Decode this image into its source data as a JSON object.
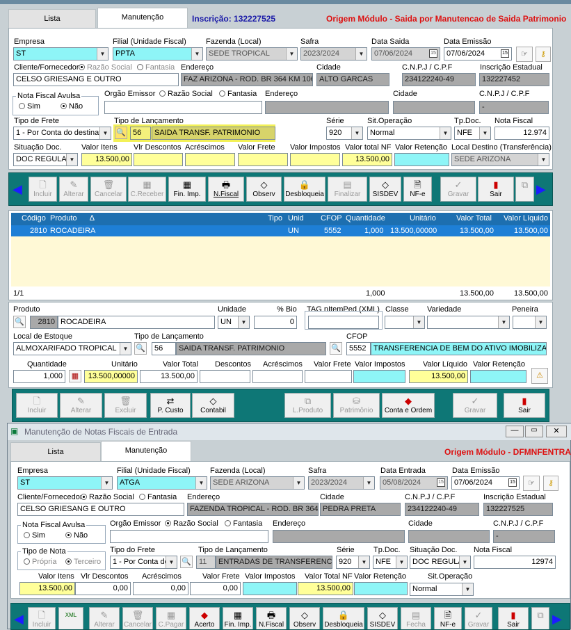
{
  "top": {
    "tabs": [
      "Lista",
      "Manutenção"
    ],
    "inscricao": "Inscrição: 132227525",
    "origem": "Origem Módulo - Saida por Manutencao de Saida Patrimonio",
    "labels": {
      "empresa": "Empresa",
      "filial": "Filial (Unidade Fiscal)",
      "fazenda": "Fazenda (Local)",
      "safra": "Safra",
      "data_saida": "Data Saida",
      "data_emissao": "Data Emissão",
      "cliente": "Cliente/Fornecedor",
      "razao": "Razão Social",
      "fantasia": "Fantasia",
      "endereco": "Endereço",
      "cidade": "Cidade",
      "cnpj": "C.N.P.J / C.P.F",
      "ie": "Inscrição Estadual",
      "nf_avulsa": "Nota Fiscal Avulsa",
      "sim": "Sim",
      "nao": "Não",
      "orgao": "Orgão Emissor",
      "razao2": "Razão Social",
      "fantasia2": "Fantasia",
      "endereco2": "Endereço",
      "cidade2": "Cidade",
      "cnpj2": "C.N.P.J / C.P.F",
      "tipo_frete": "Tipo de Frete",
      "tipo_lanc": "Tipo de Lançamento",
      "serie": "Série",
      "sit_op": "Sit.Operação",
      "tp_doc": "Tp.Doc.",
      "nota_fiscal": "Nota Fiscal",
      "situacao_doc": "Situação Doc.",
      "valor_itens": "Valor Itens",
      "vlr_desc": "Vlr Descontos",
      "acrescimos": "Acréscimos",
      "valor_frete": "Valor Frete",
      "valor_impostos": "Valor Impostos",
      "valor_total_nf": "Valor total NF",
      "valor_retencao": "Valor Retenção",
      "local_destino": "Local Destino (Transferência)"
    },
    "values": {
      "empresa": "ST",
      "filial": "PPTA",
      "fazenda": "SEDE TROPICAL",
      "safra": "2023/2024",
      "data_saida": "07/06/2024",
      "data_emissao": "07/06/2024",
      "cliente": "CELSO GRIESANG E OUTRO",
      "endereco": "FAZ ARIZONA - ROD. BR 364 KM 106",
      "cidade": "ALTO GARCAS",
      "cnpj": "234122240-49",
      "ie": "132227452",
      "cnpj2": "-",
      "tipo_frete": "1 - Por Conta do destinat",
      "tipo_lanc_cod": "56",
      "tipo_lanc_desc": "SAIDA TRANSF. PATRIMONIO",
      "serie": "920",
      "sit_op": "Normal",
      "tp_doc": "NFE",
      "nota_fiscal": "12.974",
      "situacao_doc": "DOC REGULAR",
      "valor_itens": "13.500,00",
      "valor_total_nf": "13.500,00",
      "local_destino": "SEDE ARIZONA"
    },
    "toolbar": [
      "Incluir",
      "Alterar",
      "Cancelar",
      "C.Receber",
      "Fin. Imp.",
      "N.Fiscal",
      "Observ",
      "Desbloqueia",
      "Finalizar",
      "SISDEV",
      "NF-e",
      "Gravar",
      "Sair"
    ],
    "grid": {
      "headers": [
        "Código",
        "Produto",
        "Tipo",
        "Unid",
        "CFOP",
        "Quantidade",
        "Unitário",
        "Valor Total",
        "Valor Líquido"
      ],
      "row": [
        "2810",
        "ROCADEIRA",
        "",
        "UN",
        "5552",
        "1,000",
        "13.500,00000",
        "13.500,00",
        "13.500,00"
      ],
      "footer": [
        "1/1",
        "1,000",
        "13.500,00",
        "13.500,00"
      ]
    },
    "item": {
      "labels": {
        "produto": "Produto",
        "unidade": "Unidade",
        "pct_bio": "% Bio",
        "tag": "TAG nItemPed (XML)",
        "classe": "Classe",
        "variedade": "Variedade",
        "peneira": "Peneira",
        "local_estoque": "Local de Estoque",
        "tipo_lanc": "Tipo de Lançamento",
        "cfop": "CFOP",
        "quantidade": "Quantidade",
        "unitario": "Unitário",
        "valor_total": "Valor Total",
        "descontos": "Descontos",
        "acrescimos": "Acréscimos",
        "valor_frete": "Valor Frete",
        "valor_impostos": "Valor Impostos",
        "valor_liquido": "Valor Líquido",
        "valor_retencao": "Valor Retenção"
      },
      "values": {
        "produto_cod": "2810",
        "produto_desc": "ROCADEIRA",
        "unidade": "UN",
        "pct_bio": "0",
        "local_estoque": "ALMOXARIFADO TROPICAL",
        "tipo_lanc_cod": "56",
        "tipo_lanc_desc": "SAIDA TRANSF. PATRIMONIO",
        "cfop_cod": "5552",
        "cfop_desc": "TRANSFERENCIA DE BEM DO ATIVO IMOBILIZADO",
        "quantidade": "1,000",
        "unitario": "13.500,00000",
        "valor_total": "13.500,00",
        "valor_liquido": "13.500,00"
      },
      "toolbar": [
        "Incluir",
        "Alterar",
        "Excluir",
        "P. Custo",
        "Contabil",
        "L.Produto",
        "Patrimônio",
        "Conta e Ordem",
        "Gravar",
        "Sair"
      ]
    }
  },
  "bottom": {
    "title": "Manutenção de Notas Fiscais de Entrada",
    "tabs": [
      "Lista",
      "Manutenção"
    ],
    "origem": "Origem Módulo - DFMNFENTRADA",
    "labels": {
      "empresa": "Empresa",
      "filial": "Filial (Unidade Fiscal)",
      "fazenda": "Fazenda (Local)",
      "safra": "Safra",
      "data_entrada": "Data Entrada",
      "data_emissao": "Data Emissão",
      "cliente": "Cliente/Fornecedor",
      "razao": "Razão Social",
      "fantasia": "Fantasia",
      "endereco": "Endereço",
      "cidade": "Cidade",
      "cnpj": "C.N.P.J / C.P.F",
      "ie": "Inscrição Estadual",
      "nf_avulsa": "Nota Fiscal Avulsa",
      "sim": "Sim",
      "nao": "Não",
      "orgao": "Orgão Emissor",
      "razao2": "Razão Social",
      "fantasia2": "Fantasia",
      "endereco2": "Endereço",
      "cidade2": "Cidade",
      "cnpj2": "C.N.P.J / C.P.F",
      "tipo_nota": "Tipo de Nota",
      "propria": "Própria",
      "terceiro": "Terceiro",
      "tipo_frete": "Tipo do Frete",
      "tipo_lanc": "Tipo de Lançamento",
      "serie": "Série",
      "tp_doc": "Tp.Doc.",
      "situacao_doc": "Situação Doc.",
      "nota_fiscal": "Nota Fiscal",
      "valor_itens": "Valor Itens",
      "vlr_desc": "Vlr Descontos",
      "acrescimos": "Acréscimos",
      "valor_frete": "Valor Frete",
      "valor_impostos": "Valor Impostos",
      "valor_total_nf": "Valor Total NF",
      "valor_retencao": "Valor Retenção",
      "sit_op": "Sit.Operação"
    },
    "values": {
      "empresa": "ST",
      "filial": "ATGA",
      "fazenda": "SEDE ARIZONA",
      "safra": "2023/2024",
      "data_entrada": "05/08/2024",
      "data_emissao": "07/06/2024",
      "cliente": "CELSO GRIESANG E OUTRO",
      "endereco": "FAZENDA TROPICAL - ROD. BR 364 KM",
      "cidade": "PEDRA PRETA",
      "cnpj": "234122240-49",
      "ie": "132227525",
      "cnpj2": "-",
      "tipo_frete": "1 - Por Conta do",
      "tipo_lanc_cod": "11",
      "tipo_lanc_desc": "ENTRADAS DE TRANSFERENCIAS",
      "serie": "920",
      "tp_doc": "NFE",
      "situacao_doc": "DOC REGULA",
      "nota_fiscal": "12974",
      "valor_itens": "13.500,00",
      "vlr_desc": "0,00",
      "acrescimos": "0,00",
      "valor_frete": "0,00",
      "valor_total_nf": "13.500,00",
      "sit_op": "Normal"
    },
    "toolbar": [
      "Incluir",
      "XML",
      "Alterar",
      "Cancelar",
      "C.Pagar",
      "Acerto",
      "Fin. Imp.",
      "N.Fiscal",
      "Observ",
      "Desbloqueia",
      "SISDEV",
      "Fecha",
      "NF-e",
      "Gravar",
      "Sair"
    ]
  }
}
